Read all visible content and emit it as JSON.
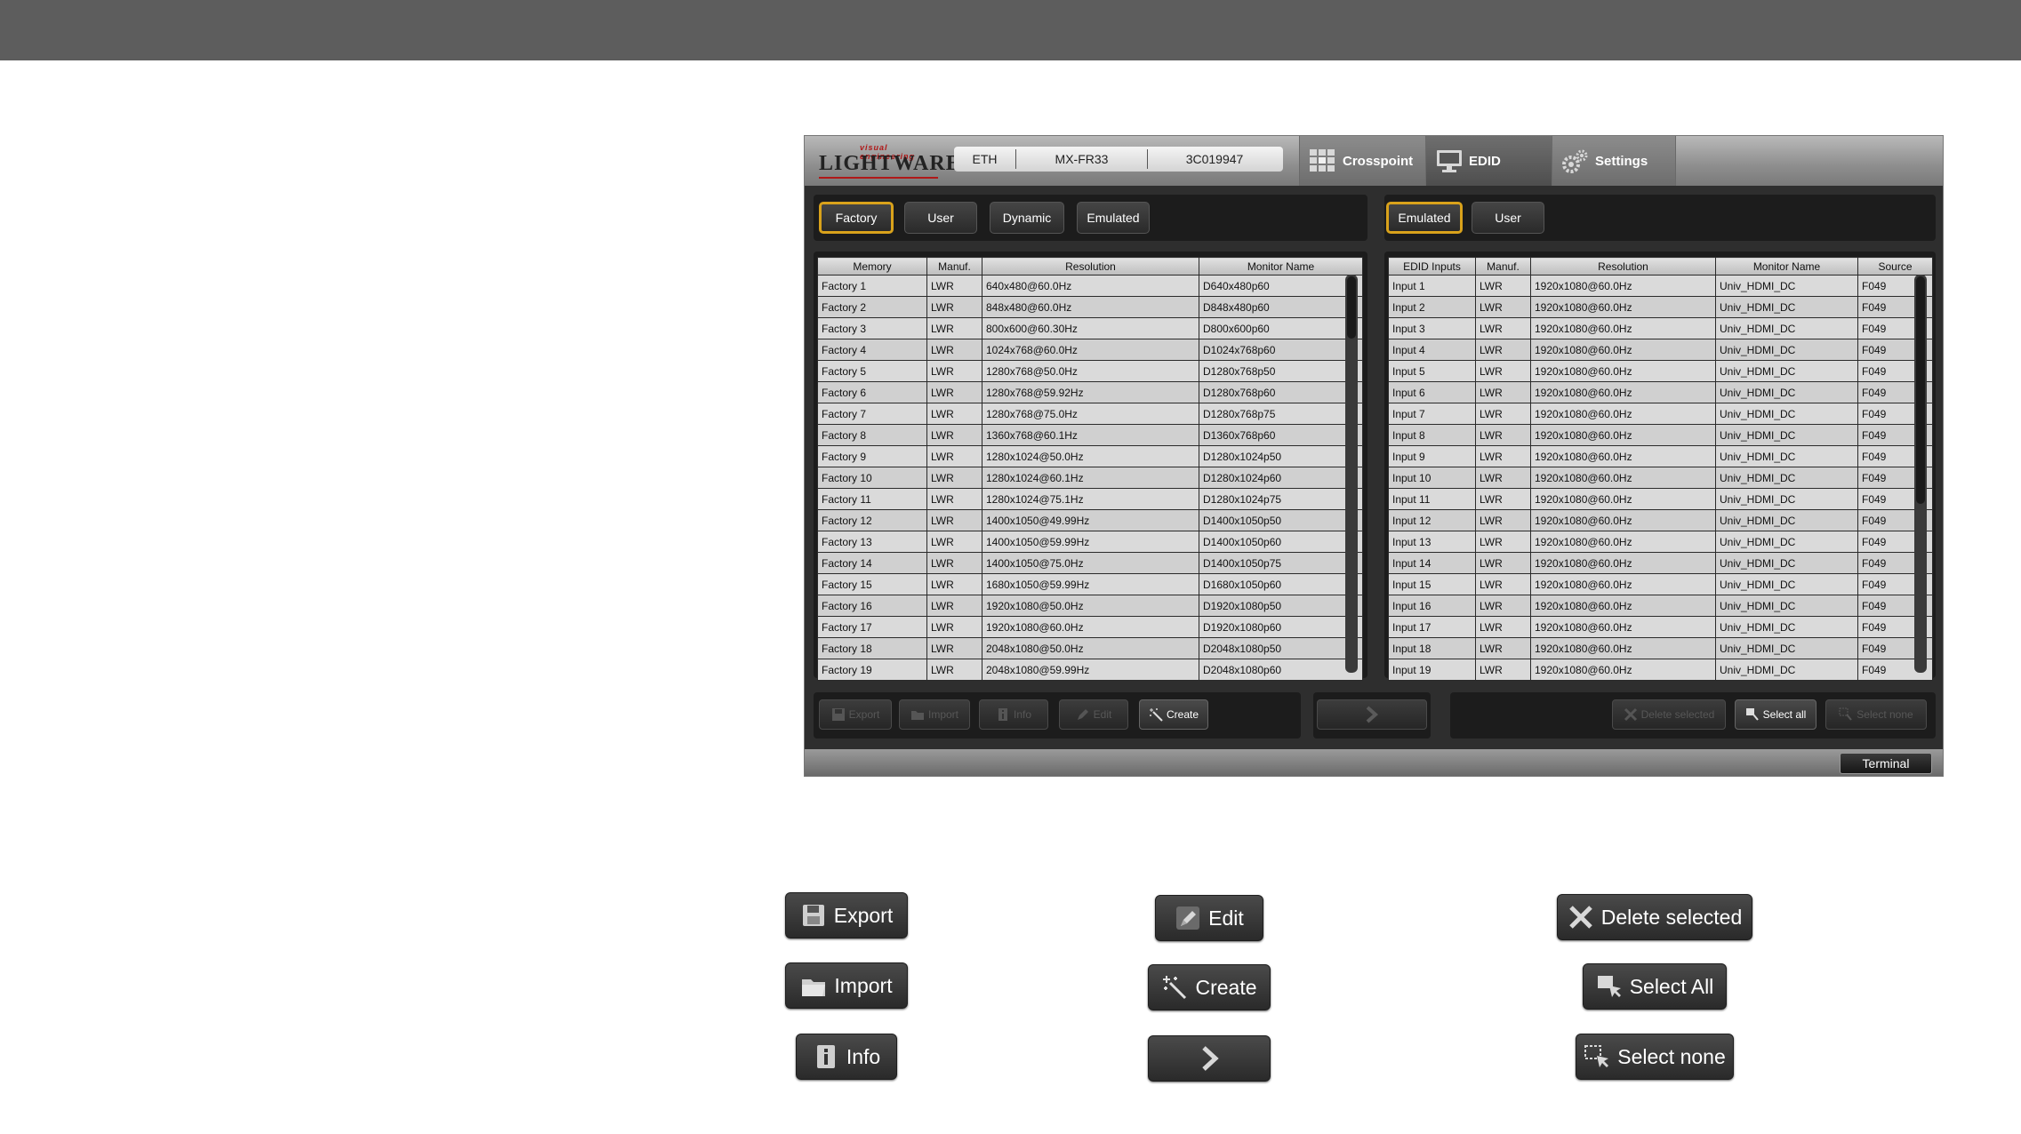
{
  "app": {
    "logo_tagline": "visual engineering",
    "logo_word": "LIGHTWARE",
    "device": {
      "interface": "ETH",
      "model": "MX-FR33",
      "serial": "3C019947"
    },
    "main_tabs": [
      {
        "label": "Crosspoint",
        "icon": "crosspoint-grid-icon"
      },
      {
        "label": "EDID",
        "icon": "monitor-icon"
      },
      {
        "label": "Settings",
        "icon": "gears-icon"
      }
    ],
    "left_tabs": [
      "Factory",
      "User",
      "Dynamic",
      "Emulated"
    ],
    "right_tabs": [
      "Emulated",
      "User"
    ],
    "left_table": {
      "headers": [
        "Memory",
        "Manuf.",
        "Resolution",
        "Monitor Name"
      ],
      "rows": [
        [
          "Factory 1",
          "LWR",
          "640x480@60.0Hz",
          "D640x480p60"
        ],
        [
          "Factory 2",
          "LWR",
          "848x480@60.0Hz",
          "D848x480p60"
        ],
        [
          "Factory 3",
          "LWR",
          "800x600@60.30Hz",
          "D800x600p60"
        ],
        [
          "Factory 4",
          "LWR",
          "1024x768@60.0Hz",
          "D1024x768p60"
        ],
        [
          "Factory 5",
          "LWR",
          "1280x768@50.0Hz",
          "D1280x768p50"
        ],
        [
          "Factory 6",
          "LWR",
          "1280x768@59.92Hz",
          "D1280x768p60"
        ],
        [
          "Factory 7",
          "LWR",
          "1280x768@75.0Hz",
          "D1280x768p75"
        ],
        [
          "Factory 8",
          "LWR",
          "1360x768@60.1Hz",
          "D1360x768p60"
        ],
        [
          "Factory 9",
          "LWR",
          "1280x1024@50.0Hz",
          "D1280x1024p50"
        ],
        [
          "Factory 10",
          "LWR",
          "1280x1024@60.1Hz",
          "D1280x1024p60"
        ],
        [
          "Factory 11",
          "LWR",
          "1280x1024@75.1Hz",
          "D1280x1024p75"
        ],
        [
          "Factory 12",
          "LWR",
          "1400x1050@49.99Hz",
          "D1400x1050p50"
        ],
        [
          "Factory 13",
          "LWR",
          "1400x1050@59.99Hz",
          "D1400x1050p60"
        ],
        [
          "Factory 14",
          "LWR",
          "1400x1050@75.0Hz",
          "D1400x1050p75"
        ],
        [
          "Factory 15",
          "LWR",
          "1680x1050@59.99Hz",
          "D1680x1050p60"
        ],
        [
          "Factory 16",
          "LWR",
          "1920x1080@50.0Hz",
          "D1920x1080p50"
        ],
        [
          "Factory 17",
          "LWR",
          "1920x1080@60.0Hz",
          "D1920x1080p60"
        ],
        [
          "Factory 18",
          "LWR",
          "2048x1080@50.0Hz",
          "D2048x1080p50"
        ],
        [
          "Factory 19",
          "LWR",
          "2048x1080@59.99Hz",
          "D2048x1080p60"
        ]
      ]
    },
    "right_table": {
      "headers": [
        "EDID Inputs",
        "Manuf.",
        "Resolution",
        "Monitor Name",
        "Source"
      ],
      "rows": [
        [
          "Input 1",
          "LWR",
          "1920x1080@60.0Hz",
          "Univ_HDMI_DC",
          "F049"
        ],
        [
          "Input 2",
          "LWR",
          "1920x1080@60.0Hz",
          "Univ_HDMI_DC",
          "F049"
        ],
        [
          "Input 3",
          "LWR",
          "1920x1080@60.0Hz",
          "Univ_HDMI_DC",
          "F049"
        ],
        [
          "Input 4",
          "LWR",
          "1920x1080@60.0Hz",
          "Univ_HDMI_DC",
          "F049"
        ],
        [
          "Input 5",
          "LWR",
          "1920x1080@60.0Hz",
          "Univ_HDMI_DC",
          "F049"
        ],
        [
          "Input 6",
          "LWR",
          "1920x1080@60.0Hz",
          "Univ_HDMI_DC",
          "F049"
        ],
        [
          "Input 7",
          "LWR",
          "1920x1080@60.0Hz",
          "Univ_HDMI_DC",
          "F049"
        ],
        [
          "Input 8",
          "LWR",
          "1920x1080@60.0Hz",
          "Univ_HDMI_DC",
          "F049"
        ],
        [
          "Input 9",
          "LWR",
          "1920x1080@60.0Hz",
          "Univ_HDMI_DC",
          "F049"
        ],
        [
          "Input 10",
          "LWR",
          "1920x1080@60.0Hz",
          "Univ_HDMI_DC",
          "F049"
        ],
        [
          "Input 11",
          "LWR",
          "1920x1080@60.0Hz",
          "Univ_HDMI_DC",
          "F049"
        ],
        [
          "Input 12",
          "LWR",
          "1920x1080@60.0Hz",
          "Univ_HDMI_DC",
          "F049"
        ],
        [
          "Input 13",
          "LWR",
          "1920x1080@60.0Hz",
          "Univ_HDMI_DC",
          "F049"
        ],
        [
          "Input 14",
          "LWR",
          "1920x1080@60.0Hz",
          "Univ_HDMI_DC",
          "F049"
        ],
        [
          "Input 15",
          "LWR",
          "1920x1080@60.0Hz",
          "Univ_HDMI_DC",
          "F049"
        ],
        [
          "Input 16",
          "LWR",
          "1920x1080@60.0Hz",
          "Univ_HDMI_DC",
          "F049"
        ],
        [
          "Input 17",
          "LWR",
          "1920x1080@60.0Hz",
          "Univ_HDMI_DC",
          "F049"
        ],
        [
          "Input 18",
          "LWR",
          "1920x1080@60.0Hz",
          "Univ_HDMI_DC",
          "F049"
        ],
        [
          "Input 19",
          "LWR",
          "1920x1080@60.0Hz",
          "Univ_HDMI_DC",
          "F049"
        ]
      ]
    },
    "toolbar": {
      "export": "Export",
      "import": "Import",
      "info": "Info",
      "edit": "Edit",
      "create": "Create",
      "delete_selected": "Delete selected",
      "select_all": "Select all",
      "select_none": "Select none"
    },
    "terminal": "Terminal",
    "accent_color": "#d9a21b"
  },
  "legend": {
    "export": "Export",
    "import": "Import",
    "info": "Info",
    "edit": "Edit",
    "create": "Create",
    "delete_selected": "Delete selected",
    "select_all": "Select All",
    "select_none": "Select none"
  }
}
